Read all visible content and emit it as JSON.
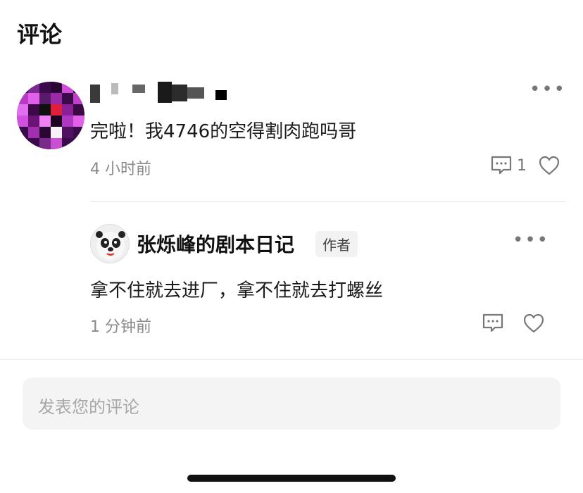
{
  "header": {
    "title": "评论"
  },
  "comments": [
    {
      "text": "完啦！我4746的空得割肉跑吗哥",
      "time": "4 小时前",
      "reply_count": "1",
      "icons": {
        "more": "more-icon",
        "reply": "comment-icon",
        "like": "heart-icon"
      }
    }
  ],
  "replies": [
    {
      "username": "张烁峰的剧本日记",
      "badge": "作者",
      "text": "拿不住就去进厂，拿不住就去打螺丝",
      "time": "1 分钟前",
      "icons": {
        "more": "more-icon",
        "reply": "comment-icon",
        "like": "heart-icon"
      }
    }
  ],
  "input": {
    "placeholder": "发表您的评论"
  },
  "colors": {
    "text": "#1a1a1a",
    "muted": "#8a8a8a",
    "input_bg": "#f4f4f5"
  }
}
